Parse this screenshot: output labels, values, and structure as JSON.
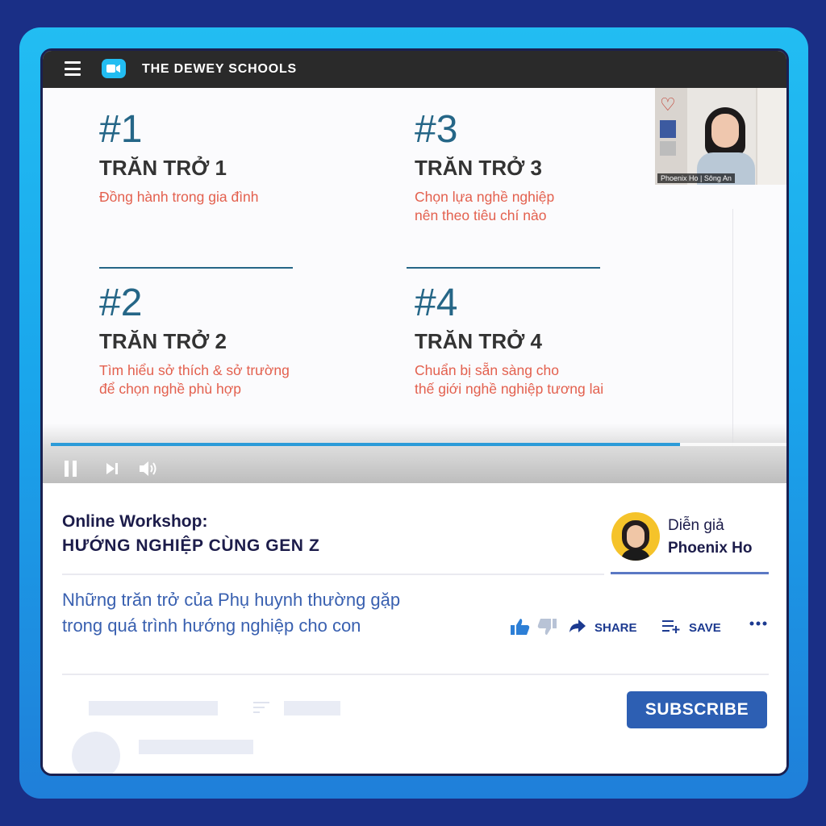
{
  "app": {
    "brand": "THE DEWEY SCHOOLS"
  },
  "slide": {
    "items": [
      {
        "num": "#1",
        "title": "TRĂN TRỞ 1",
        "desc1": "Đồng hành trong gia đình",
        "desc2": ""
      },
      {
        "num": "#2",
        "title": "TRĂN TRỞ 2",
        "desc1": "Tìm hiểu sở thích & sở trường",
        "desc2": "để chọn nghề phù hợp"
      },
      {
        "num": "#3",
        "title": "TRĂN TRỞ 3",
        "desc1": "Chọn lựa nghề nghiệp",
        "desc2": "nên theo tiêu chí nào"
      },
      {
        "num": "#4",
        "title": "TRĂN TRỞ 4",
        "desc1": "Chuẩn bị sẵn sàng cho",
        "desc2": "thế giới nghề nghiệp tương lai"
      }
    ]
  },
  "camera": {
    "label": "Phoenix Ho | Sông An"
  },
  "player": {
    "progress_fraction": 0.855
  },
  "workshop": {
    "line1": "Online Workshop:",
    "line2": "HƯỚNG NGHIỆP CÙNG GEN Z"
  },
  "speaker": {
    "label": "Diễn giả",
    "name": "Phoenix Ho"
  },
  "description": {
    "line1": "Những trăn trở của Phụ huynh thường gặp",
    "line2": "trong quá trình hướng nghiệp cho con"
  },
  "actions": {
    "share": "SHARE",
    "save": "SAVE"
  },
  "subscribe": {
    "label": "SUBSCRIBE"
  },
  "icons": [
    "hamburger-icon",
    "video-camera-icon",
    "pause-icon",
    "skip-next-icon",
    "volume-icon",
    "thumbs-up-icon",
    "thumbs-down-icon",
    "share-icon",
    "save-playlist-icon",
    "more-icon",
    "sort-icon"
  ],
  "colors": {
    "accent": "#256687",
    "desc": "#e3604e",
    "brand_blue": "#2d5fb3",
    "frame": "#22bdf2",
    "navy_bg": "#1a2f86"
  }
}
